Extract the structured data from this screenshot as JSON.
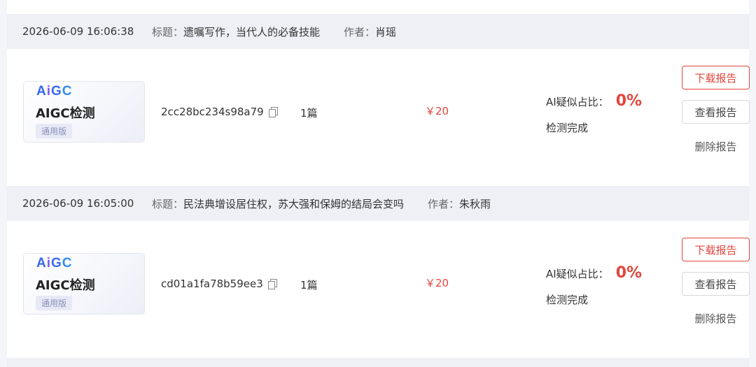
{
  "orders": [
    {
      "time": "2026-06-09 16:06:38",
      "title_label": "标题：",
      "title": "遗嘱写作，当代人的必备技能",
      "author_label": "作者：",
      "author": "肖瑶",
      "product": {
        "logo": [
          "A",
          "i",
          "G",
          "C"
        ],
        "name": "AIGC检测",
        "badge": "通用版"
      },
      "order_id": "2cc28bc234s98a79",
      "quantity": "1篇",
      "price": "￥20",
      "ratio_label": "AI疑似占比：",
      "ratio_value": "0%",
      "status": "检测完成",
      "buttons": {
        "download": "下载报告",
        "view": "查看报告",
        "delete": "删除报告"
      }
    },
    {
      "time": "2026-06-09 16:05:00",
      "title_label": "标题：",
      "title": "民法典增设居住权，苏大强和保姆的结局会变吗",
      "author_label": "作者：",
      "author": "朱秋雨",
      "product": {
        "logo": [
          "A",
          "i",
          "G",
          "C"
        ],
        "name": "AIGC检测",
        "badge": "通用版"
      },
      "order_id": "cd01a1fa78b59ee3",
      "quantity": "1篇",
      "price": "￥20",
      "ratio_label": "AI疑似占比：",
      "ratio_value": "0%",
      "status": "检测完成",
      "buttons": {
        "download": "下载报告",
        "view": "查看报告",
        "delete": "删除报告"
      }
    }
  ],
  "colors": {
    "accent_red": "#e0463d",
    "header_bg": "#eef0f6",
    "page_bg": "#f4f5f9"
  },
  "icons": {
    "copy": "copy-icon"
  }
}
